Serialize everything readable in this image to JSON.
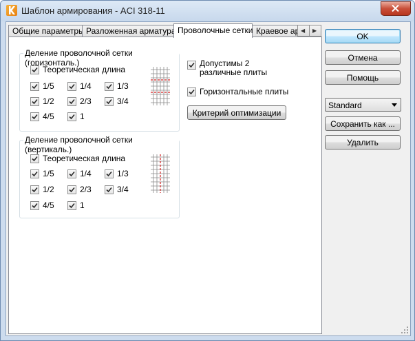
{
  "window": {
    "title": "Шаблон армирования - ACI 318-11"
  },
  "tabs": [
    {
      "label": "Общие параметры"
    },
    {
      "label": "Разложенная арматура"
    },
    {
      "label": "Проволочные сетки"
    },
    {
      "label": "Краевое арм"
    }
  ],
  "groups": {
    "horizontal": {
      "title": "Деление проволочной сетки (горизонталь.)",
      "theoretical": "Теоретическая длина",
      "fractions": [
        "1/5",
        "1/4",
        "1/3",
        "1/2",
        "2/3",
        "3/4",
        "4/5",
        "1"
      ]
    },
    "vertical": {
      "title": "Деление проволочной сетки (вертикаль.)",
      "theoretical": "Теоретическая длина",
      "fractions": [
        "1/5",
        "1/4",
        "1/3",
        "1/2",
        "2/3",
        "3/4",
        "4/5",
        "1"
      ]
    }
  },
  "options": {
    "different_plates": "Допустимы 2 различные плиты",
    "horizontal_plates": "Горизонтальные плиты",
    "optimize_button": "Критерий оптимизации"
  },
  "buttons": {
    "ok": "OK",
    "cancel": "Отмена",
    "help": "Помощь",
    "save_as": "Сохранить как ...",
    "delete": "Удалить"
  },
  "template_select": {
    "value": "Standard"
  },
  "colors": {
    "mesh_line": "#8a8a8a",
    "mesh_cut": "#d21e1e",
    "accent": "#3c7fb1"
  }
}
